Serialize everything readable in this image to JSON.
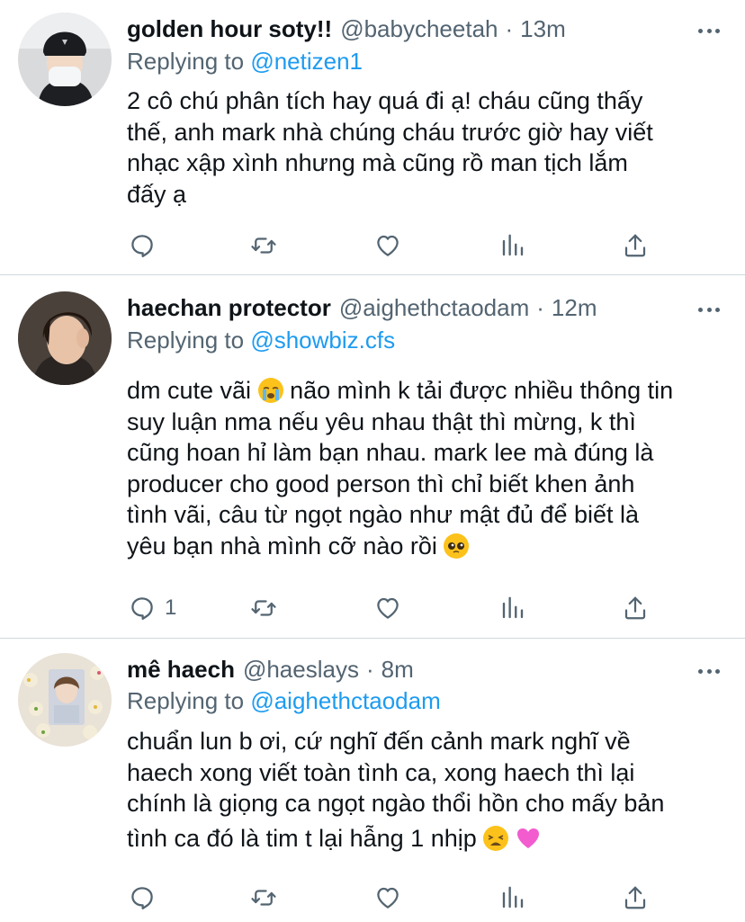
{
  "tweets": [
    {
      "name": "golden hour soty!!",
      "handle": "@babycheetah",
      "dot": "·",
      "time": "13m",
      "reply_prefix": "Replying to",
      "reply_to": "@netizen1",
      "lines": [
        "2 cô chú phân tích hay quá đi ạ! cháu cũng thấy",
        "thế, anh mark nhà chúng cháu trước giờ hay viết",
        "nhạc xập xình nhưng mà cũng rồ man tịch lắm",
        "đấy ạ"
      ],
      "reply_count": ""
    },
    {
      "name": "haechan protector",
      "handle": "@aighethctaodam",
      "dot": "·",
      "time": "12m",
      "reply_prefix": "Replying to",
      "reply_to": "@showbiz.cfs",
      "lines": [
        "dm cute vãi",
        "suy luận nma nếu yêu nhau thật thì mừng, k thì",
        "cũng hoan hỉ làm bạn nhau. mark lee mà đúng là",
        "producer cho good person thì chỉ biết khen ảnh",
        "tình vãi, câu từ ngọt ngào như mật đủ để biết là",
        "yêu bạn nhà mình cỡ nào rồi"
      ],
      "line0_suffix": "não mình k tải được nhiều thông tin",
      "emoji_a": "crying-face",
      "emoji_b": "pleading-face",
      "reply_count": "1"
    },
    {
      "name": "mê haech",
      "handle": "@haeslays",
      "dot": "·",
      "time": "8m",
      "reply_prefix": "Replying to",
      "reply_to": "@aighethctaodam",
      "lines": [
        "chuẩn lun b ơi, cứ nghĩ đến cảnh mark nghĩ về",
        "haech xong viết toàn tình ca, xong haech thì lại",
        "chính là giọng ca ngọt ngào thổi hồn cho mấy bản",
        "tình ca đó là tim t lại hẫng 1 nhịp"
      ],
      "emoji_a": "weary-face",
      "emoji_b": "pink-heart",
      "reply_count": ""
    }
  ],
  "colors": {
    "text": "#0f1419",
    "secondary": "#536471",
    "link": "#1d9bf0",
    "divider": "#cfd9de"
  },
  "icons": [
    "reply-icon",
    "retweet-icon",
    "like-icon",
    "analytics-icon",
    "share-icon",
    "more-icon"
  ]
}
